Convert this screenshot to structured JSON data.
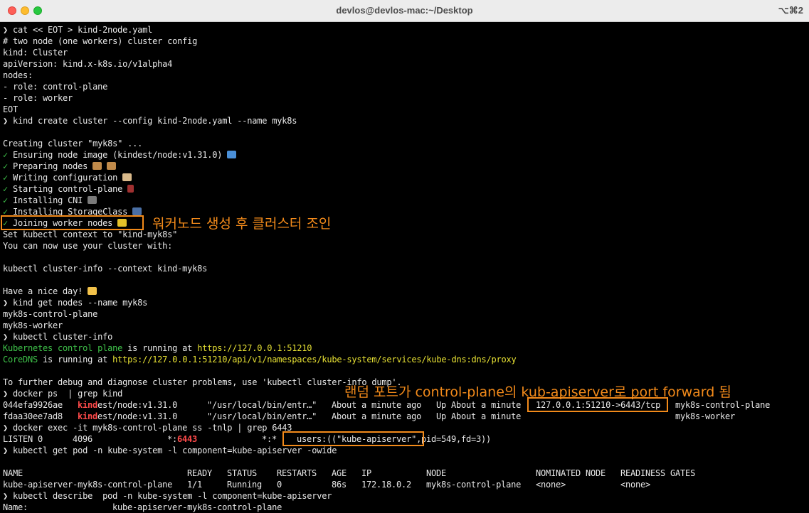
{
  "window": {
    "title": "devlos@devlos-mac:~/Desktop",
    "shortcut": "⌥⌘2"
  },
  "colors": {
    "orange_annotation": "#f28a1a",
    "green": "#3fc34a",
    "yellow": "#e6e033",
    "red": "#ff4a4a"
  },
  "lines": {
    "l1": "❯ cat << EOT > kind-2node.yaml",
    "l2": "# two node (one workers) cluster config",
    "l3": "kind: Cluster",
    "l4": "apiVersion: kind.x-k8s.io/v1alpha4",
    "l5": "nodes:",
    "l6": "- role: control-plane",
    "l7": "- role: worker",
    "l8": "EOT",
    "l9": "❯ kind create cluster --config kind-2node.yaml --name myk8s",
    "l11": "Creating cluster \"myk8s\" ...",
    "l12": "Ensuring node image (kindest/node:v1.31.0)",
    "l13": "Preparing nodes",
    "l14": "Writing configuration",
    "l15": "Starting control-plane",
    "l16": "Installing CNI",
    "l17": "Installing StorageClass",
    "l18": "Joining worker nodes",
    "l19": "Set kubectl context to \"kind-myk8s\"",
    "l20": "You can now use your cluster with:",
    "l22": "kubectl cluster-info --context kind-myk8s",
    "l24": "Have a nice day!",
    "l25": "❯ kind get nodes --name myk8s",
    "l26": "myk8s-control-plane",
    "l27": "myk8s-worker",
    "l28": "❯ kubectl cluster-info",
    "l29a": "Kubernetes control plane",
    "l29b": " is running at ",
    "l29c": "https://127.0.0.1:51210",
    "l30a": "CoreDNS",
    "l30b": " is running at ",
    "l30c": "https://127.0.0.1:51210/api/v1/namespaces/kube-system/services/kube-dns:dns/proxy",
    "l32": "To further debug and diagnose cluster problems, use 'kubectl cluster-info dump'.",
    "l33": "❯ docker ps  | grep kind",
    "l36": "❯ docker exec -it myk8s-control-plane ss -tnlp | grep 6443",
    "l38": "❯ kubectl get pod -n kube-system -l component=kube-apiserver -owide",
    "l43": "❯ kubectl describe  pod -n kube-system -l component=kube-apiserver",
    "l44a": "Name:",
    "l44b": "kube-apiserver-myk8s-control-plane"
  },
  "check": "✓",
  "docker_rows": [
    {
      "id": "044efa9926ae",
      "image_hl": "kind",
      "image_rest": "est/node:v1.31.0",
      "command": "\"/usr/local/bin/entr…\"",
      "created": "About a minute ago",
      "status": "Up About a minute",
      "ports": "127.0.0.1:51210->6443/tcp",
      "name": "myk8s-control-plane"
    },
    {
      "id": "fdaa30ee7ad8",
      "image_hl": "kind",
      "image_rest": "est/node:v1.31.0",
      "command": "\"/usr/local/bin/entr…\"",
      "created": "About a minute ago",
      "status": "Up About a minute",
      "ports": "",
      "name": "myk8s-worker"
    }
  ],
  "ss_row": {
    "state": "LISTEN 0",
    "recvq": "4096",
    "local_a": "*:",
    "local_b": "6443",
    "peer": "*:*",
    "users": "users:((\"kube-apiserver\",",
    "pid": "pid=549,fd=3))"
  },
  "pod_table": {
    "headers": [
      "NAME",
      "READY",
      "STATUS",
      "RESTARTS",
      "AGE",
      "IP",
      "NODE",
      "NOMINATED NODE",
      "READINESS GATES"
    ],
    "row": [
      "kube-apiserver-myk8s-control-plane",
      "1/1",
      "Running",
      "0",
      "86s",
      "172.18.0.2",
      "myk8s-control-plane",
      "<none>",
      "<none>"
    ]
  },
  "annotations": {
    "worker_join": "워커노드 생성 후 클러스터 조인",
    "port_forward": "랜덤 포트가 control-plane의 kub-apiserver로 port forward 됨"
  }
}
